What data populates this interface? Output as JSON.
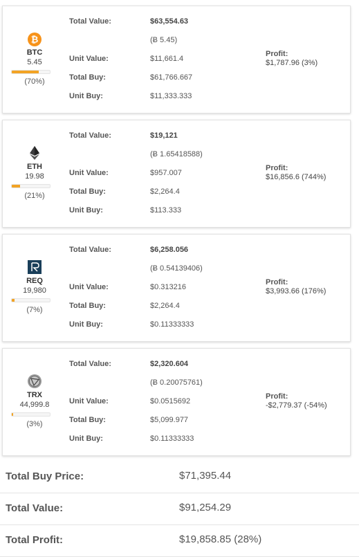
{
  "labels": {
    "total_value": "Total Value:",
    "unit_value": "Unit Value:",
    "total_buy": "Total Buy:",
    "unit_buy": "Unit Buy:",
    "profit": "Profit:"
  },
  "coins": [
    {
      "symbol": "BTC",
      "icon": "bitcoin-icon",
      "color": "#f7931a",
      "quantity": "5.45",
      "percent_label": "(70%)",
      "share": 0.7,
      "total_value": "$63,554.63",
      "btc_value": "(Ƀ 5.45)",
      "unit_value": "$11,661.4",
      "total_buy": "$61,766.667",
      "unit_buy": "$11,333.333",
      "profit": "$1,787.96 (3%)"
    },
    {
      "symbol": "ETH",
      "icon": "ethereum-icon",
      "color": "#3c3c3d",
      "quantity": "19.98",
      "percent_label": "(21%)",
      "share": 0.21,
      "total_value": "$19,121",
      "btc_value": "(Ƀ 1.65418588)",
      "unit_value": "$957.007",
      "total_buy": "$2,264.4",
      "unit_buy": "$113.333",
      "profit": "$16,856.6 (744%)"
    },
    {
      "symbol": "REQ",
      "icon": "request-network-icon",
      "color": "#1a3f5a",
      "quantity": "19,980",
      "percent_label": "(7%)",
      "share": 0.07,
      "total_value": "$6,258.056",
      "btc_value": "(Ƀ 0.54139406)",
      "unit_value": "$0.313216",
      "total_buy": "$2,264.4",
      "unit_buy": "$0.11333333",
      "profit": "$3,993.66 (176%)"
    },
    {
      "symbol": "TRX",
      "icon": "tron-icon",
      "color": "#888888",
      "quantity": "44,999.8",
      "percent_label": "(3%)",
      "share": 0.03,
      "total_value": "$2,320.604",
      "btc_value": "(Ƀ 0.20075761)",
      "unit_value": "$0.0515692",
      "total_buy": "$5,099.977",
      "unit_buy": "$0.11333333",
      "profit": "-$2,779.37 (-54%)"
    }
  ],
  "summary": {
    "total_buy_label": "Total Buy Price:",
    "total_buy_value": "$71,395.44",
    "total_value_label": "Total Value:",
    "total_value_value": "$91,254.29",
    "total_profit_label": "Total Profit:",
    "total_profit_value": "$19,858.85 (28%)"
  },
  "colors": {
    "bar_fill": "#f2a324"
  }
}
